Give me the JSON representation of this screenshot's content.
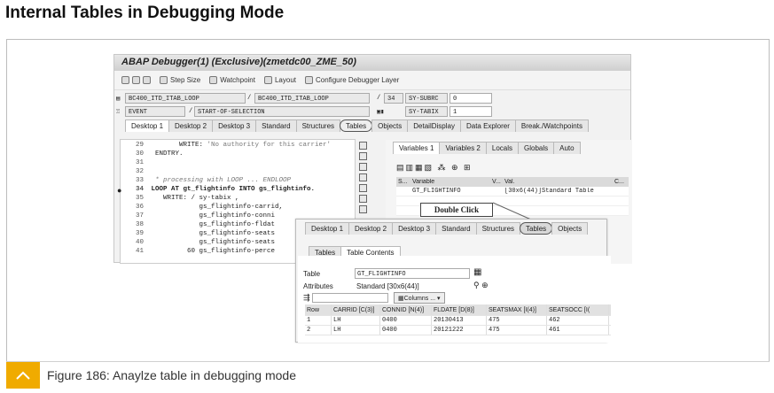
{
  "page": {
    "heading": "Internal Tables in Debugging Mode",
    "caption": "Figure 186: Anaylze table in debugging mode",
    "accent_color": "#f0ab00"
  },
  "debugger": {
    "title": "ABAP Debugger(1)  (Exclusive)(zmetdc00_ZME_50)",
    "toolbar": [
      "Step Size",
      "Watchpoint",
      "Layout",
      "Configure Debugger Layer"
    ],
    "program_row": {
      "left": "BC400_ITD_ITAB_LOOP",
      "right": "BC400_ITD_ITAB_LOOP",
      "line": "34",
      "sysfield": "SY-SUBRC",
      "sysvalue": "0"
    },
    "event_row": {
      "left": "EVENT",
      "right": "START-OF-SELECTION",
      "sysfield": "SY-TABIX",
      "sysvalue": "1"
    },
    "tabs": [
      "Desktop 1",
      "Desktop 2",
      "Desktop 3",
      "Standard",
      "Structures",
      "Tables",
      "Objects",
      "DetailDisplay",
      "Data Explorer",
      "Break./Watchpoints"
    ],
    "code": [
      {
        "num": "29",
        "text": "        WRITE: ",
        "str": "'No authority for this carrier'"
      },
      {
        "num": "30",
        "text": "  ENDTRY."
      },
      {
        "num": "31",
        "text": ""
      },
      {
        "num": "32",
        "text": ""
      },
      {
        "num": "33",
        "text": "",
        "comment": "  * processing with LOOP ... ENDLOOP"
      },
      {
        "num": "34",
        "text": " LOOP AT gt_flightinfo INTO gs_flightinfo."
      },
      {
        "num": "35",
        "text": "    WRITE: / sy-tabix ,"
      },
      {
        "num": "36",
        "text": "             gs_flightinfo-carrid,"
      },
      {
        "num": "37",
        "text": "             gs_flightinfo-conni"
      },
      {
        "num": "38",
        "text": "             gs_flightinfo-fldat"
      },
      {
        "num": "39",
        "text": "             gs_flightinfo-seats"
      },
      {
        "num": "40",
        "text": "             gs_flightinfo-seats"
      },
      {
        "num": "41",
        "text": "          60 gs_flightinfo-perce"
      }
    ],
    "var_tabs": [
      "Variables 1",
      "Variables 2",
      "Locals",
      "Globals",
      "Auto"
    ],
    "var_headers": [
      "S...",
      "Variable",
      "V...",
      "Val.",
      "C..."
    ],
    "var_rows": [
      {
        "variable": "GT_FLIGHTINFO",
        "value": "[30x6(44)]Standard Table"
      }
    ],
    "callout": "Double Click"
  },
  "table_view": {
    "tabs": [
      "Desktop 1",
      "Desktop 2",
      "Desktop 3",
      "Standard",
      "Structures",
      "Tables",
      "Objects"
    ],
    "subtabs": [
      "Tables",
      "Table Contents"
    ],
    "table_label": "Table",
    "table_value": "GT_FLIGHTINFO",
    "attributes_label": "Attributes",
    "attributes_value": "Standard [30x6(44)]",
    "columns_button": "Columns ...",
    "headers": [
      "Row",
      "CARRID [C(3)]",
      "CONNID [N(4)]",
      "FLDATE [D(8)]",
      "SEATSMAX [I(4)]",
      "SEATSOCC [I("
    ],
    "rows": [
      [
        "1",
        "LH",
        "0400",
        "20130413",
        "475",
        "462"
      ],
      [
        "2",
        "LH",
        "0400",
        "20121222",
        "475",
        "461"
      ]
    ]
  }
}
